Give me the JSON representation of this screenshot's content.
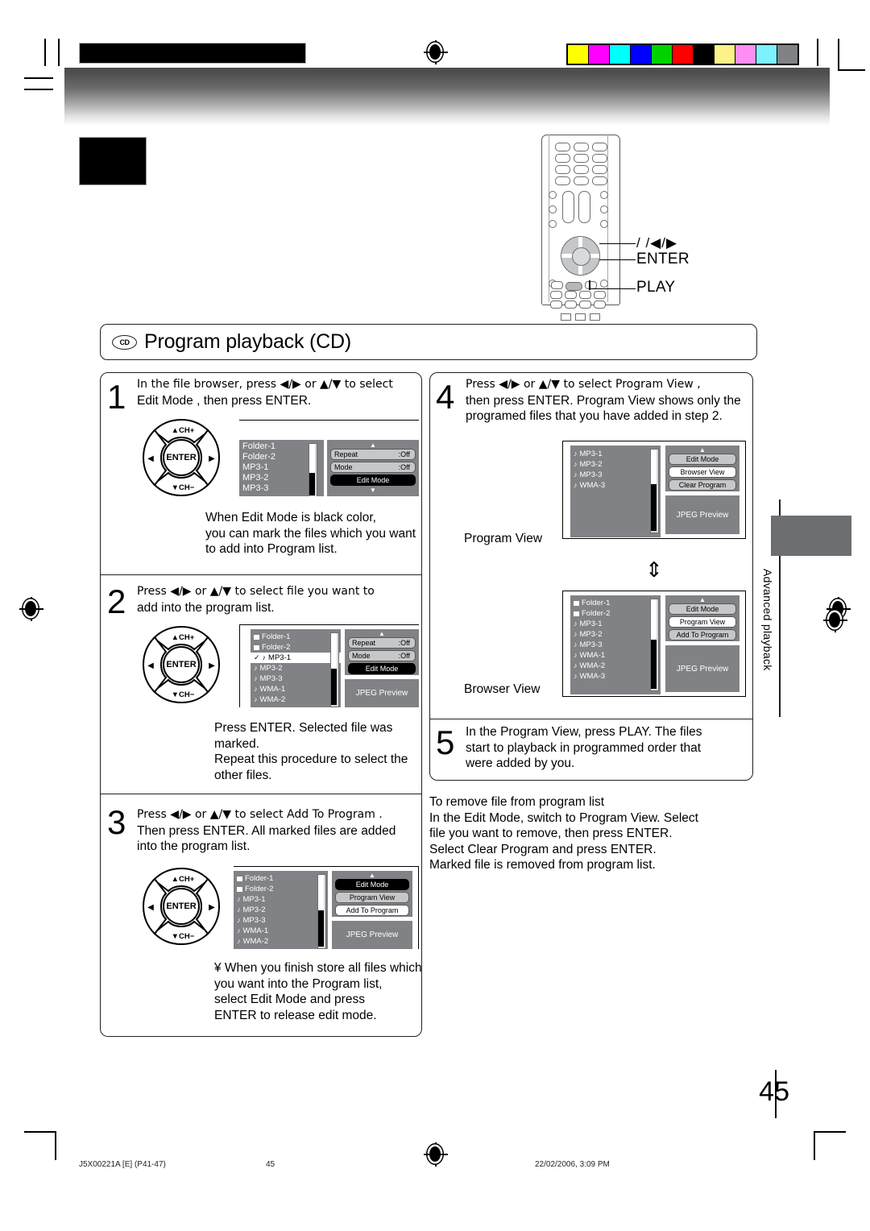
{
  "page": {
    "number": "45",
    "side_tab": "Advanced playback"
  },
  "footer": {
    "doc_code": "J5X00221A [E] (P41-47)",
    "page": "45",
    "timestamp": "22/02/2006, 3:09 PM"
  },
  "section": {
    "badge": "CD",
    "title": "Program playback (CD)"
  },
  "remote": {
    "callout_arrows": "/   /◀/▶",
    "callout_enter": "ENTER",
    "callout_play": "PLAY"
  },
  "steps": {
    "s1": {
      "num": "1",
      "line1": "In the file browser, press   ◀/▶ or ▲/▼ to select",
      "line2": "Edit Mode , then press ENTER.",
      "note": [
        "When  Edit Mode  is black color,",
        "you can mark the files which you want",
        "to add into Program list."
      ]
    },
    "s2": {
      "num": "2",
      "line1": "Press ◀/▶ or ▲/▼ to select file you want to",
      "line2": "add into the program list.",
      "note": [
        "Press ENTER. Selected file was",
        "marked.",
        "Repeat this procedure to select the",
        "other files."
      ]
    },
    "s3": {
      "num": "3",
      "line1": "Press ◀/▶ or ▲/▼ to select  Add To Program .",
      "line2": "Then press ENTER. All marked files are added",
      "line3": "into the program list.",
      "note": [
        "¥ When you finish store all files which",
        "you want into the Program list,",
        "select  Edit Mode  and press",
        "ENTER to release edit mode."
      ]
    },
    "s4": {
      "num": "4",
      "line1": "Press ◀/▶ or ▲/▼ to select   Program View  ,",
      "line2": "then press ENTER. Program View shows only the",
      "line3": "programed files that you have added in step 2."
    },
    "s5": {
      "num": "5",
      "line1": "In the Program View, press PLAY. The files",
      "line2": "start to playback in programmed order that",
      "line3": "were added by you."
    }
  },
  "labels": {
    "program_view": "Program View",
    "browser_view": "Browser View"
  },
  "remove_note": [
    "To remove file from program list",
    "In the Edit Mode, switch to Program View. Select",
    "file you want to remove, then press ENTER.",
    "Select  Clear Program  and press ENTER.",
    "Marked file is removed from program list."
  ],
  "chpad": {
    "up": "CH+",
    "down": "CH−",
    "center": "ENTER"
  },
  "osd": {
    "screen1": {
      "files": [
        "Folder-1",
        "Folder-2",
        "MP3-1",
        "MP3-2",
        "MP3-3"
      ],
      "menu": [
        {
          "label": "Repeat",
          "value": ":Off",
          "state": "normal"
        },
        {
          "label": "Mode",
          "value": ":Off",
          "state": "normal"
        },
        {
          "label": "Edit Mode",
          "value": "",
          "state": "black"
        }
      ]
    },
    "screen2": {
      "files": [
        {
          "name": "Folder-1",
          "icon": "folder",
          "checked": false,
          "selected": false
        },
        {
          "name": "Folder-2",
          "icon": "folder",
          "checked": false,
          "selected": false
        },
        {
          "name": "MP3-1",
          "icon": "note",
          "checked": true,
          "selected": true
        },
        {
          "name": "MP3-2",
          "icon": "note",
          "checked": false,
          "selected": false
        },
        {
          "name": "MP3-3",
          "icon": "note",
          "checked": false,
          "selected": false
        },
        {
          "name": "WMA-1",
          "icon": "note",
          "checked": false,
          "selected": false
        },
        {
          "name": "WMA-2",
          "icon": "note",
          "checked": false,
          "selected": false
        }
      ],
      "menu": [
        {
          "label": "Repeat",
          "value": ":Off",
          "state": "normal"
        },
        {
          "label": "Mode",
          "value": ":Off",
          "state": "normal"
        },
        {
          "label": "Edit Mode",
          "value": "",
          "state": "black"
        }
      ],
      "jpeg": "JPEG Preview"
    },
    "screen3": {
      "files": [
        {
          "name": "Folder-1",
          "icon": "folder"
        },
        {
          "name": "Folder-2",
          "icon": "folder"
        },
        {
          "name": "MP3-1",
          "icon": "note"
        },
        {
          "name": "MP3-2",
          "icon": "note"
        },
        {
          "name": "MP3-3",
          "icon": "note"
        },
        {
          "name": "WMA-1",
          "icon": "note"
        },
        {
          "name": "WMA-2",
          "icon": "note"
        }
      ],
      "menu": [
        {
          "label": "Edit Mode",
          "state": "black"
        },
        {
          "label": "Program View",
          "state": "normal"
        },
        {
          "label": "Add To Program",
          "state": "white"
        }
      ],
      "jpeg": "JPEG Preview"
    },
    "program_view": {
      "files": [
        "MP3-1",
        "MP3-2",
        "MP3-3",
        "WMA-3"
      ],
      "menu": [
        {
          "label": "Edit Mode",
          "state": "normal"
        },
        {
          "label": "Browser View",
          "state": "white"
        },
        {
          "label": "Clear Program",
          "state": "normal"
        }
      ],
      "jpeg": "JPEG Preview"
    },
    "browser_view": {
      "files": [
        {
          "name": "Folder-1",
          "icon": "folder"
        },
        {
          "name": "Folder-2",
          "icon": "folder"
        },
        {
          "name": "MP3-1",
          "icon": "note"
        },
        {
          "name": "MP3-2",
          "icon": "note"
        },
        {
          "name": "MP3-3",
          "icon": "note"
        },
        {
          "name": "WMA-1",
          "icon": "note"
        },
        {
          "name": "WMA-2",
          "icon": "note"
        },
        {
          "name": "WMA-3",
          "icon": "note"
        }
      ],
      "menu": [
        {
          "label": "Edit Mode",
          "state": "normal"
        },
        {
          "label": "Program View",
          "state": "white"
        },
        {
          "label": "Add To Program",
          "state": "normal"
        }
      ],
      "jpeg": "JPEG Preview"
    }
  },
  "colorbar": [
    "#ffff00",
    "#ff00ff",
    "#00ffff",
    "#0000ff",
    "#00d200",
    "#ff0000",
    "#000000",
    "#fdf18a",
    "#ff8ef3",
    "#7ef1ff",
    "#808285"
  ]
}
